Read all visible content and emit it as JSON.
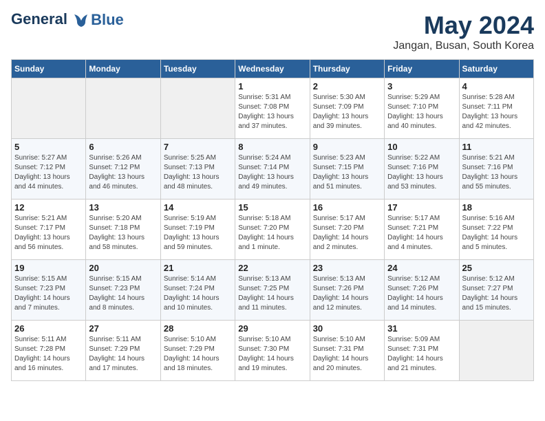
{
  "logo": {
    "line1": "General",
    "line2": "Blue"
  },
  "title": "May 2024",
  "location": "Jangan, Busan, South Korea",
  "days_of_week": [
    "Sunday",
    "Monday",
    "Tuesday",
    "Wednesday",
    "Thursday",
    "Friday",
    "Saturday"
  ],
  "weeks": [
    [
      {
        "day": "",
        "info": ""
      },
      {
        "day": "",
        "info": ""
      },
      {
        "day": "",
        "info": ""
      },
      {
        "day": "1",
        "info": "Sunrise: 5:31 AM\nSunset: 7:08 PM\nDaylight: 13 hours and 37 minutes."
      },
      {
        "day": "2",
        "info": "Sunrise: 5:30 AM\nSunset: 7:09 PM\nDaylight: 13 hours and 39 minutes."
      },
      {
        "day": "3",
        "info": "Sunrise: 5:29 AM\nSunset: 7:10 PM\nDaylight: 13 hours and 40 minutes."
      },
      {
        "day": "4",
        "info": "Sunrise: 5:28 AM\nSunset: 7:11 PM\nDaylight: 13 hours and 42 minutes."
      }
    ],
    [
      {
        "day": "5",
        "info": "Sunrise: 5:27 AM\nSunset: 7:12 PM\nDaylight: 13 hours and 44 minutes."
      },
      {
        "day": "6",
        "info": "Sunrise: 5:26 AM\nSunset: 7:12 PM\nDaylight: 13 hours and 46 minutes."
      },
      {
        "day": "7",
        "info": "Sunrise: 5:25 AM\nSunset: 7:13 PM\nDaylight: 13 hours and 48 minutes."
      },
      {
        "day": "8",
        "info": "Sunrise: 5:24 AM\nSunset: 7:14 PM\nDaylight: 13 hours and 49 minutes."
      },
      {
        "day": "9",
        "info": "Sunrise: 5:23 AM\nSunset: 7:15 PM\nDaylight: 13 hours and 51 minutes."
      },
      {
        "day": "10",
        "info": "Sunrise: 5:22 AM\nSunset: 7:16 PM\nDaylight: 13 hours and 53 minutes."
      },
      {
        "day": "11",
        "info": "Sunrise: 5:21 AM\nSunset: 7:16 PM\nDaylight: 13 hours and 55 minutes."
      }
    ],
    [
      {
        "day": "12",
        "info": "Sunrise: 5:21 AM\nSunset: 7:17 PM\nDaylight: 13 hours and 56 minutes."
      },
      {
        "day": "13",
        "info": "Sunrise: 5:20 AM\nSunset: 7:18 PM\nDaylight: 13 hours and 58 minutes."
      },
      {
        "day": "14",
        "info": "Sunrise: 5:19 AM\nSunset: 7:19 PM\nDaylight: 13 hours and 59 minutes."
      },
      {
        "day": "15",
        "info": "Sunrise: 5:18 AM\nSunset: 7:20 PM\nDaylight: 14 hours and 1 minute."
      },
      {
        "day": "16",
        "info": "Sunrise: 5:17 AM\nSunset: 7:20 PM\nDaylight: 14 hours and 2 minutes."
      },
      {
        "day": "17",
        "info": "Sunrise: 5:17 AM\nSunset: 7:21 PM\nDaylight: 14 hours and 4 minutes."
      },
      {
        "day": "18",
        "info": "Sunrise: 5:16 AM\nSunset: 7:22 PM\nDaylight: 14 hours and 5 minutes."
      }
    ],
    [
      {
        "day": "19",
        "info": "Sunrise: 5:15 AM\nSunset: 7:23 PM\nDaylight: 14 hours and 7 minutes."
      },
      {
        "day": "20",
        "info": "Sunrise: 5:15 AM\nSunset: 7:23 PM\nDaylight: 14 hours and 8 minutes."
      },
      {
        "day": "21",
        "info": "Sunrise: 5:14 AM\nSunset: 7:24 PM\nDaylight: 14 hours and 10 minutes."
      },
      {
        "day": "22",
        "info": "Sunrise: 5:13 AM\nSunset: 7:25 PM\nDaylight: 14 hours and 11 minutes."
      },
      {
        "day": "23",
        "info": "Sunrise: 5:13 AM\nSunset: 7:26 PM\nDaylight: 14 hours and 12 minutes."
      },
      {
        "day": "24",
        "info": "Sunrise: 5:12 AM\nSunset: 7:26 PM\nDaylight: 14 hours and 14 minutes."
      },
      {
        "day": "25",
        "info": "Sunrise: 5:12 AM\nSunset: 7:27 PM\nDaylight: 14 hours and 15 minutes."
      }
    ],
    [
      {
        "day": "26",
        "info": "Sunrise: 5:11 AM\nSunset: 7:28 PM\nDaylight: 14 hours and 16 minutes."
      },
      {
        "day": "27",
        "info": "Sunrise: 5:11 AM\nSunset: 7:29 PM\nDaylight: 14 hours and 17 minutes."
      },
      {
        "day": "28",
        "info": "Sunrise: 5:10 AM\nSunset: 7:29 PM\nDaylight: 14 hours and 18 minutes."
      },
      {
        "day": "29",
        "info": "Sunrise: 5:10 AM\nSunset: 7:30 PM\nDaylight: 14 hours and 19 minutes."
      },
      {
        "day": "30",
        "info": "Sunrise: 5:10 AM\nSunset: 7:31 PM\nDaylight: 14 hours and 20 minutes."
      },
      {
        "day": "31",
        "info": "Sunrise: 5:09 AM\nSunset: 7:31 PM\nDaylight: 14 hours and 21 minutes."
      },
      {
        "day": "",
        "info": ""
      }
    ]
  ]
}
